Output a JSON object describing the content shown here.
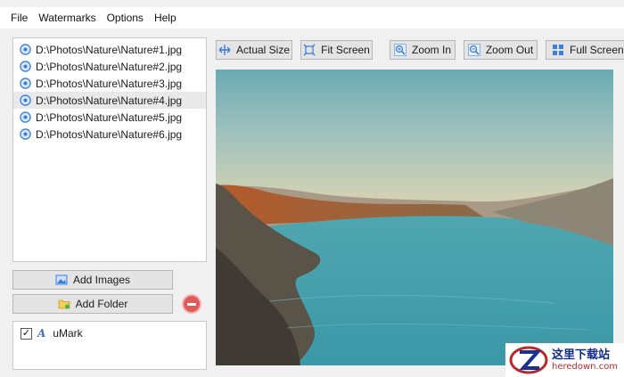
{
  "menu": [
    "File",
    "Watermarks",
    "Options",
    "Help"
  ],
  "files": [
    {
      "path": "D:\\Photos\\Nature\\Nature#1.jpg",
      "selected": false
    },
    {
      "path": "D:\\Photos\\Nature\\Nature#2.jpg",
      "selected": false
    },
    {
      "path": "D:\\Photos\\Nature\\Nature#3.jpg",
      "selected": false
    },
    {
      "path": "D:\\Photos\\Nature\\Nature#4.jpg",
      "selected": true
    },
    {
      "path": "D:\\Photos\\Nature\\Nature#5.jpg",
      "selected": false
    },
    {
      "path": "D:\\Photos\\Nature\\Nature#6.jpg",
      "selected": false
    }
  ],
  "buttons": {
    "add_images": "Add Images",
    "add_folder": "Add Folder"
  },
  "watermarks": [
    {
      "checked": true,
      "type_glyph": "A",
      "name": "uMark"
    }
  ],
  "toolbar": {
    "actual_size": "Actual Size",
    "fit_screen": "Fit Screen",
    "zoom_in": "Zoom In",
    "zoom_out": "Zoom Out",
    "full_screen": "Full Screen"
  },
  "logo": {
    "chinese": "这里下载站",
    "domain": "heredown.com"
  },
  "colors": {
    "accent_icon": "#3b7dd8",
    "remove_button": "#e05a5a",
    "selection": "#e9e9e9"
  }
}
